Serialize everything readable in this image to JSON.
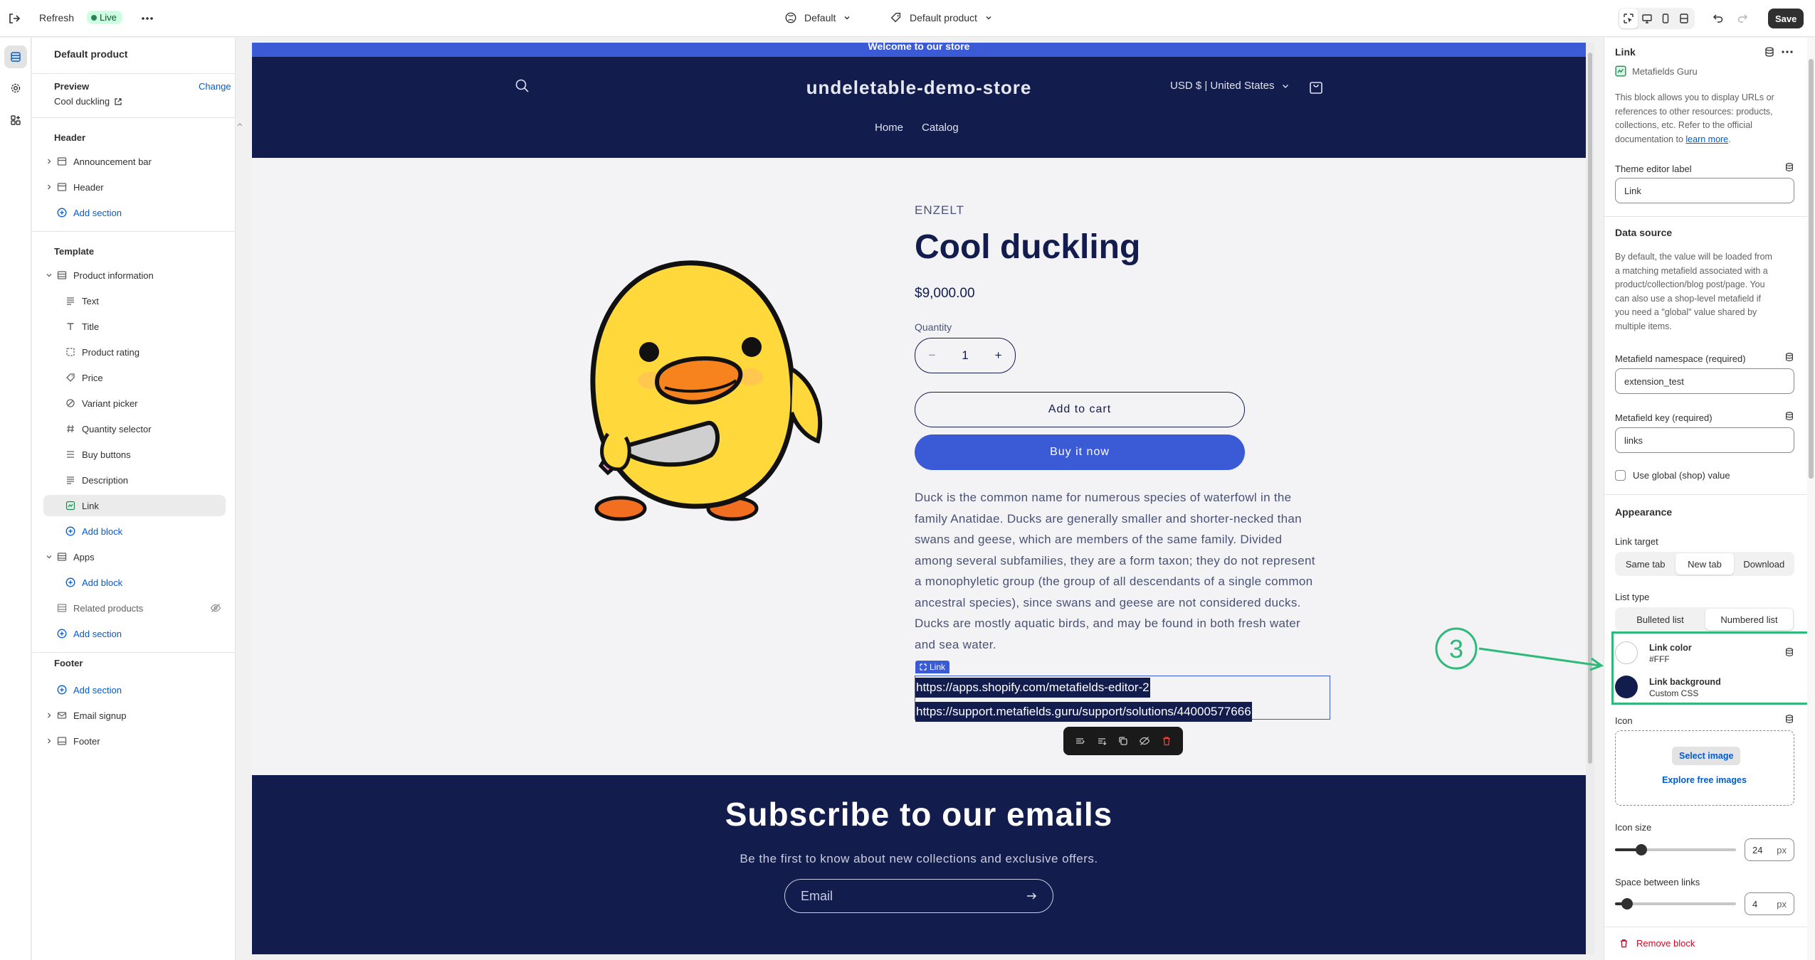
{
  "topbar": {
    "refresh": "Refresh",
    "live": "Live",
    "theme": "Default",
    "template": "Default product",
    "save": "Save"
  },
  "sidebar": {
    "title": "Default product",
    "preview_label": "Preview",
    "change": "Change",
    "preview_value": "Cool duckling",
    "header_section": "Header",
    "header_items": [
      "Announcement bar",
      "Header"
    ],
    "add_section": "Add section",
    "template_section": "Template",
    "product_information": "Product information",
    "blocks": [
      "Text",
      "Title",
      "Product rating",
      "Price",
      "Variant picker",
      "Quantity selector",
      "Buy buttons",
      "Description",
      "Link"
    ],
    "add_block": "Add block",
    "apps": "Apps",
    "related_products": "Related products",
    "footer_section": "Footer",
    "footer_items": [
      "Email signup",
      "Footer"
    ]
  },
  "store": {
    "announcement": "Welcome to our store",
    "title": "undeletable-demo-store",
    "currency": "USD $ | United States",
    "nav": [
      "Home",
      "Catalog"
    ],
    "vendor": "ENZELT",
    "product_title": "Cool duckling",
    "price": "$9,000.00",
    "quantity_label": "Quantity",
    "quantity": "1",
    "add_to_cart": "Add to cart",
    "buy_now": "Buy it now",
    "description_lines": [
      "Duck is the common name for numerous species of waterfowl in the",
      "family Anatidae. Ducks are generally smaller and shorter-necked than",
      "swans and geese, which are members of the same family. Divided",
      "among several subfamilies, they are a form taxon; they do not represent",
      "a monophyletic group (the group of all descendants of a single common",
      "ancestral species), since swans and geese are not considered ducks.",
      "Ducks are mostly aquatic birds, and may be found in both fresh water",
      "and sea water."
    ],
    "link_tag": "Link",
    "links": [
      "https://apps.shopify.com/metafields-editor-2",
      "https://support.metafields.guru/support/solutions/44000577666"
    ],
    "subscribe_title": "Subscribe to our emails",
    "subscribe_text": "Be the first to know about new collections and exclusive offers.",
    "email_placeholder": "Email"
  },
  "annotation": {
    "number": "3",
    "color": "#2fb97b"
  },
  "panel": {
    "title": "Link",
    "app_name": "Metafields Guru",
    "intro_lines": [
      "This block allows you to display URLs or",
      "references to other resources: products,",
      "collections, etc. Refer to the official",
      "documentation to"
    ],
    "learn_more": "learn more",
    "editor_label": "Theme editor label",
    "editor_value": "Link",
    "data_source": "Data source",
    "ds_lines": [
      "By default, the value will be loaded from",
      "a matching metafield associated with a",
      "product/collection/blog post/page. You",
      "can also use a shop-level metafield if",
      "you need a \"global\" value shared by",
      "multiple items."
    ],
    "ns_label": "Metafield namespace (required)",
    "ns_value": "extension_test",
    "key_label": "Metafield key (required)",
    "key_value": "links",
    "global_label": "Use global (shop) value",
    "appearance": "Appearance",
    "target_label": "Link target",
    "targets": [
      "Same tab",
      "New tab",
      "Download"
    ],
    "list_label": "List type",
    "lists": [
      "Bulleted list",
      "Numbered list"
    ],
    "link_color_label": "Link color",
    "link_color_value": "#FFF",
    "link_bg_label": "Link background",
    "link_bg_value": "Custom CSS",
    "icon_label": "Icon",
    "select_image": "Select image",
    "explore": "Explore free images",
    "icon_size_label": "Icon size",
    "icon_size": "24",
    "icon_size_fraction": 0.22,
    "space_label": "Space between links",
    "space": "4",
    "space_fraction": 0.1,
    "unit": "px",
    "remove": "Remove block",
    "colors": {
      "link_color": "#ffffff",
      "link_bg": "#121c4d"
    }
  }
}
